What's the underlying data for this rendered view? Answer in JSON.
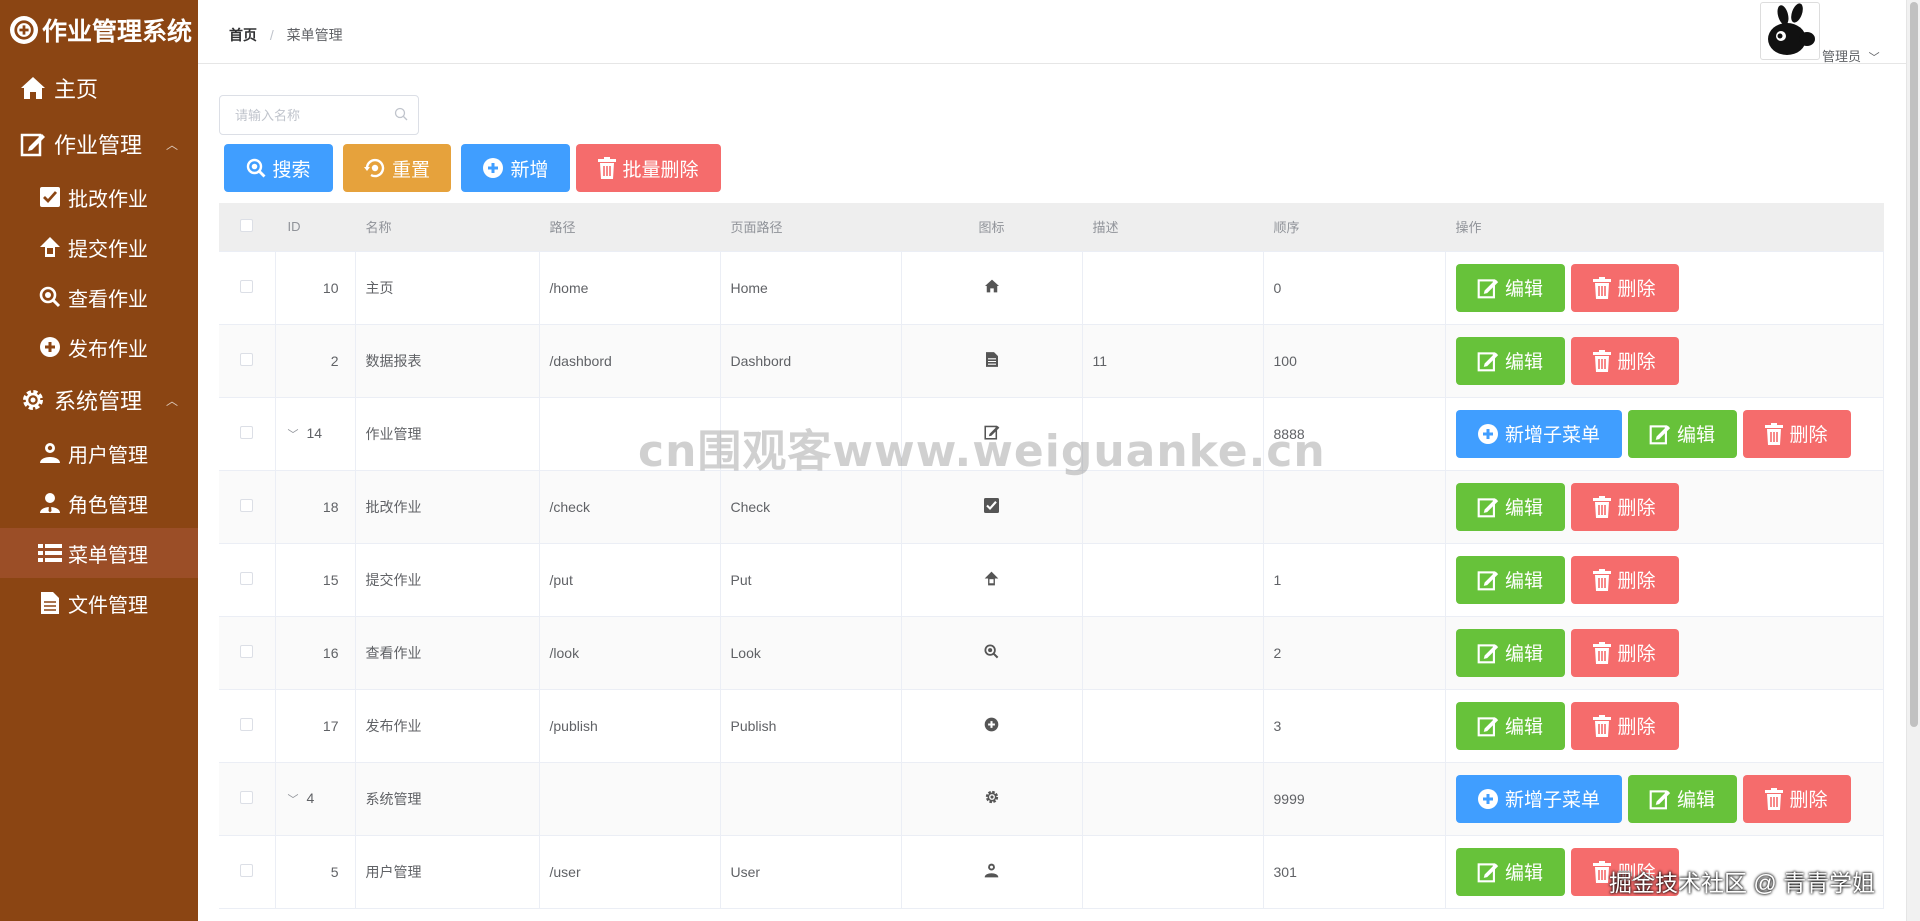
{
  "app": {
    "title": "作业管理系统"
  },
  "sidebar": {
    "items": [
      {
        "label": "主页",
        "icon": "home-icon"
      },
      {
        "label": "作业管理",
        "icon": "edit-icon",
        "children": [
          {
            "label": "批改作业",
            "icon": "check-square-icon"
          },
          {
            "label": "提交作业",
            "icon": "upload-icon"
          },
          {
            "label": "查看作业",
            "icon": "search-icon"
          },
          {
            "label": "发布作业",
            "icon": "publish-icon"
          }
        ]
      },
      {
        "label": "系统管理",
        "icon": "gear-icon",
        "children": [
          {
            "label": "用户管理",
            "icon": "user-icon"
          },
          {
            "label": "角色管理",
            "icon": "user-tie-icon"
          },
          {
            "label": "菜单管理",
            "icon": "list-icon"
          },
          {
            "label": "文件管理",
            "icon": "file-icon"
          }
        ]
      }
    ]
  },
  "header": {
    "breadcrumb": [
      "首页",
      "菜单管理"
    ],
    "user": "管理员"
  },
  "search": {
    "placeholder": "请输入名称"
  },
  "toolbar": {
    "search_label": "搜索",
    "reset_label": "重置",
    "add_label": "新增",
    "batch_delete_label": "批量删除"
  },
  "table": {
    "columns": [
      "ID",
      "名称",
      "路径",
      "页面路径",
      "图标",
      "描述",
      "顺序",
      "操作"
    ],
    "rows": [
      {
        "id": "10",
        "name": "主页",
        "path": "/home",
        "page": "Home",
        "icon": "home-icon",
        "desc": "",
        "order": "0",
        "has_children": false,
        "top": true
      },
      {
        "id": "2",
        "name": "数据报表",
        "path": "/dashbord",
        "page": "Dashbord",
        "icon": "file-icon",
        "desc": "11",
        "order": "100",
        "has_children": false,
        "top": true
      },
      {
        "id": "14",
        "name": "作业管理",
        "path": "",
        "page": "",
        "icon": "edit-icon",
        "desc": "",
        "order": "8888",
        "has_children": true,
        "top": true
      },
      {
        "id": "18",
        "name": "批改作业",
        "path": "/check",
        "page": "Check",
        "icon": "check-square-icon",
        "desc": "",
        "order": "",
        "has_children": false,
        "top": false
      },
      {
        "id": "15",
        "name": "提交作业",
        "path": "/put",
        "page": "Put",
        "icon": "upload-icon",
        "desc": "",
        "order": "1",
        "has_children": false,
        "top": false
      },
      {
        "id": "16",
        "name": "查看作业",
        "path": "/look",
        "page": "Look",
        "icon": "search-icon",
        "desc": "",
        "order": "2",
        "has_children": false,
        "top": false
      },
      {
        "id": "17",
        "name": "发布作业",
        "path": "/publish",
        "page": "Publish",
        "icon": "publish-icon",
        "desc": "",
        "order": "3",
        "has_children": false,
        "top": false
      },
      {
        "id": "4",
        "name": "系统管理",
        "path": "",
        "page": "",
        "icon": "gear-icon",
        "desc": "",
        "order": "9999",
        "has_children": true,
        "top": true
      },
      {
        "id": "5",
        "name": "用户管理",
        "path": "/user",
        "page": "User",
        "icon": "user-icon",
        "desc": "",
        "order": "301",
        "has_children": false,
        "top": false
      }
    ],
    "ops": {
      "add_child": "新增子菜单",
      "edit": "编辑",
      "delete": "删除"
    }
  },
  "watermarks": {
    "center": "cn围观客www.weiguanke.cn",
    "corner": "掘金技术社区 @ 青青学姐"
  },
  "colors": {
    "sidebar": "#8b4513",
    "primary": "#409eff",
    "warning": "#e6a23c",
    "danger": "#f56c6c",
    "success": "#67c23a"
  }
}
